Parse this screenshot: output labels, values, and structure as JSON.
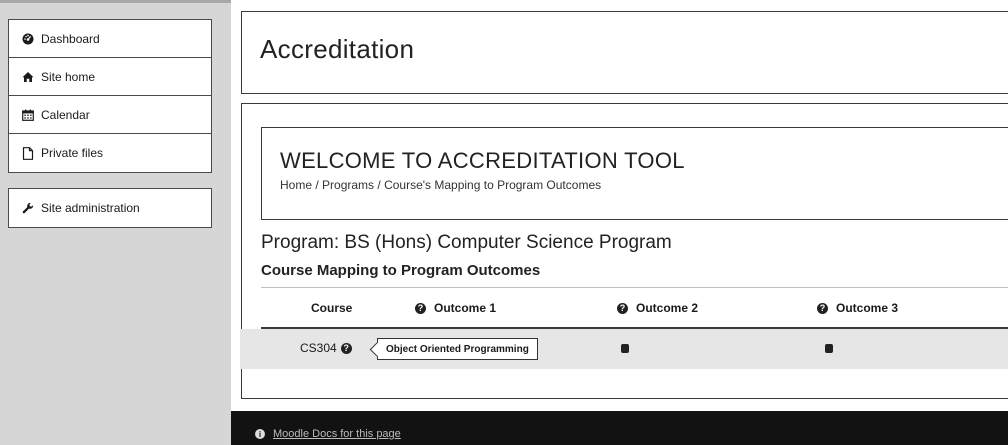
{
  "sidebar": {
    "items": [
      {
        "label": "Dashboard",
        "icon": "dashboard-icon"
      },
      {
        "label": "Site home",
        "icon": "home-icon"
      },
      {
        "label": "Calendar",
        "icon": "calendar-icon"
      },
      {
        "label": "Private files",
        "icon": "file-icon"
      }
    ],
    "admin": {
      "label": "Site administration",
      "icon": "wrench-icon"
    }
  },
  "page": {
    "title": "Accreditation"
  },
  "welcome": {
    "title": "WELCOME TO ACCREDITATION TOOL",
    "breadcrumb": [
      "Home",
      "Programs",
      "Course's Mapping to Program Outcomes"
    ],
    "separator": " / "
  },
  "program": {
    "label": "Program:",
    "name": "BS (Hons) Computer Science Program"
  },
  "mapping": {
    "heading": "Course Mapping to Program Outcomes",
    "columns": [
      "Course",
      "Outcome 1",
      "Outcome 2",
      "Outcome 3"
    ],
    "rows": [
      {
        "course": "CS304",
        "tooltip": "Object Oriented Programming",
        "outcomes": [
          true,
          true,
          true
        ]
      }
    ]
  },
  "footer": {
    "link": "Moodle Docs for this page"
  },
  "colors": {
    "sidebar_bg": "#d6d6d6",
    "row_bg": "#e6e6e6",
    "footer_bg": "#121212"
  }
}
